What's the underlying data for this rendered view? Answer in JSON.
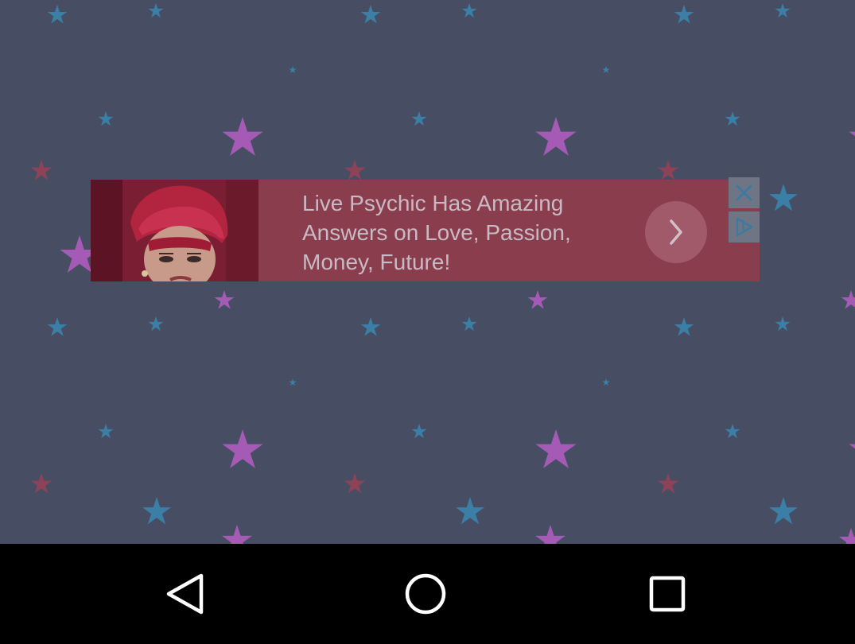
{
  "ad": {
    "lines": [
      "Live Psychic Has Amazing",
      "Answers on Love, Passion,",
      "Money, Future!"
    ],
    "close_icon": "close-icon",
    "choices_icon": "ad-choices-icon",
    "arrow_icon": "chevron-right-icon"
  },
  "nav_bar": {
    "back_icon": "back-triangle-icon",
    "home_icon": "home-circle-icon",
    "recents_icon": "recents-square-icon"
  },
  "colors": {
    "background": "#474e63",
    "star_pink": "#a55bb6",
    "star_blue": "#3b7fa6",
    "star_red": "#8e4257",
    "ad_background": "#8a3d4c",
    "nav_background": "#000000"
  }
}
